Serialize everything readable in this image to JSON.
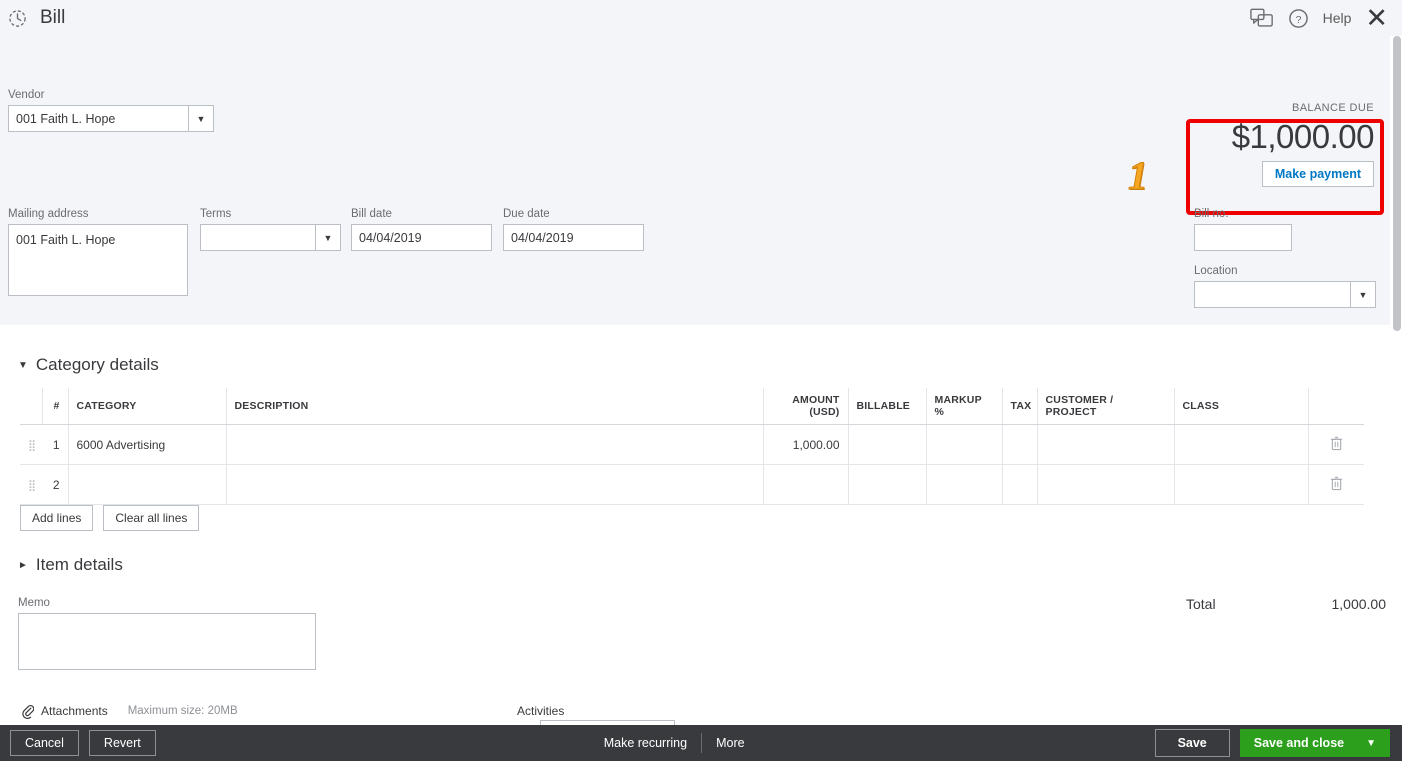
{
  "header": {
    "title": "Bill",
    "clock_icon": "history-clock-icon",
    "chat_icon": "chat-bubbles-icon",
    "help_icon": "question-circle-icon",
    "help_label": "Help",
    "close_label": "✕"
  },
  "balance": {
    "label": "BALANCE DUE",
    "amount": "$1,000.00",
    "make_payment_label": "Make payment",
    "annotation_number": "1",
    "annotation_color": "#ee0000"
  },
  "vendor": {
    "label": "Vendor",
    "value": "001 Faith L. Hope"
  },
  "mailing_address": {
    "label": "Mailing address",
    "value": "001 Faith L. Hope"
  },
  "terms": {
    "label": "Terms",
    "value": ""
  },
  "bill_date": {
    "label": "Bill date",
    "value": "04/04/2019"
  },
  "due_date": {
    "label": "Due date",
    "value": "04/04/2019"
  },
  "bill_no": {
    "label": "Bill no.",
    "value": ""
  },
  "location": {
    "label": "Location",
    "value": ""
  },
  "category_details": {
    "title": "Category details",
    "expanded": true,
    "columns": [
      "#",
      "CATEGORY",
      "DESCRIPTION",
      "AMOUNT (USD)",
      "BILLABLE",
      "MARKUP %",
      "TAX",
      "CUSTOMER / PROJECT",
      "CLASS"
    ],
    "rows": [
      {
        "num": "1",
        "category": "6000 Advertising",
        "description": "",
        "amount": "1,000.00",
        "billable": "",
        "markup": "",
        "tax": "",
        "customer_project": "",
        "class": ""
      },
      {
        "num": "2",
        "category": "",
        "description": "",
        "amount": "",
        "billable": "",
        "markup": "",
        "tax": "",
        "customer_project": "",
        "class": ""
      }
    ],
    "add_lines_label": "Add lines",
    "clear_all_lines_label": "Clear all lines"
  },
  "item_details": {
    "title": "Item details",
    "expanded": false
  },
  "memo": {
    "label": "Memo",
    "value": ""
  },
  "total": {
    "label": "Total",
    "value": "1,000.00"
  },
  "attachments": {
    "label": "Attachments",
    "icon": "paperclip-icon",
    "max_size": "Maximum size: 20MB"
  },
  "activities": {
    "label": "Activities"
  },
  "footer": {
    "cancel_label": "Cancel",
    "revert_label": "Revert",
    "make_recurring_label": "Make recurring",
    "more_label": "More",
    "save_label": "Save",
    "save_and_close_label": "Save and close",
    "save_color": "#2ca01c"
  }
}
